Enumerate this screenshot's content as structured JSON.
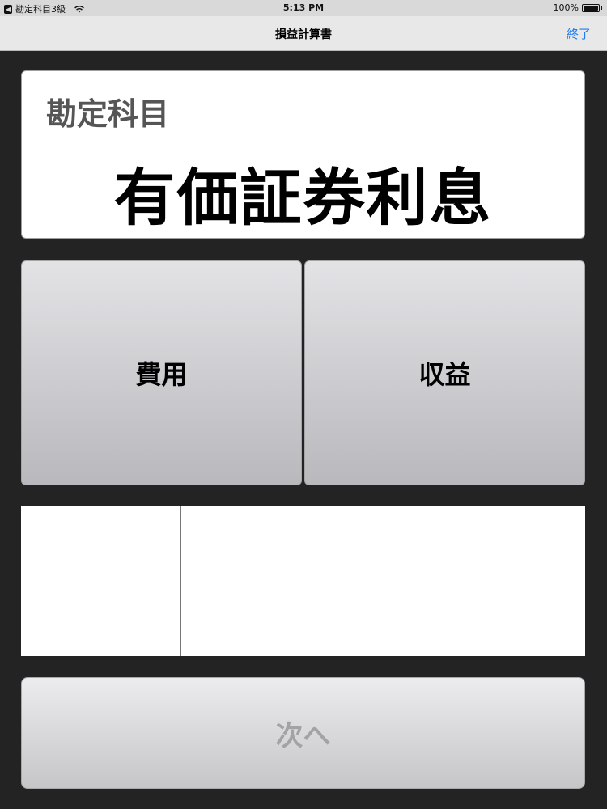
{
  "status_bar": {
    "back_app": "勘定科目3級",
    "time": "5:13 PM",
    "battery": "100%"
  },
  "nav": {
    "title": "損益計算書",
    "done_label": "終了"
  },
  "account": {
    "label": "勘定科目",
    "name": "有価証券利息"
  },
  "choices": {
    "expense_label": "費用",
    "revenue_label": "収益"
  },
  "next": {
    "label": "次へ"
  },
  "colors": {
    "background": "#232323",
    "accent": "#1f7cf0",
    "disabled_text": "#a3a3a3"
  },
  "icons": {
    "back": "back-arrow-icon",
    "wifi": "wifi-icon",
    "battery": "battery-icon"
  }
}
